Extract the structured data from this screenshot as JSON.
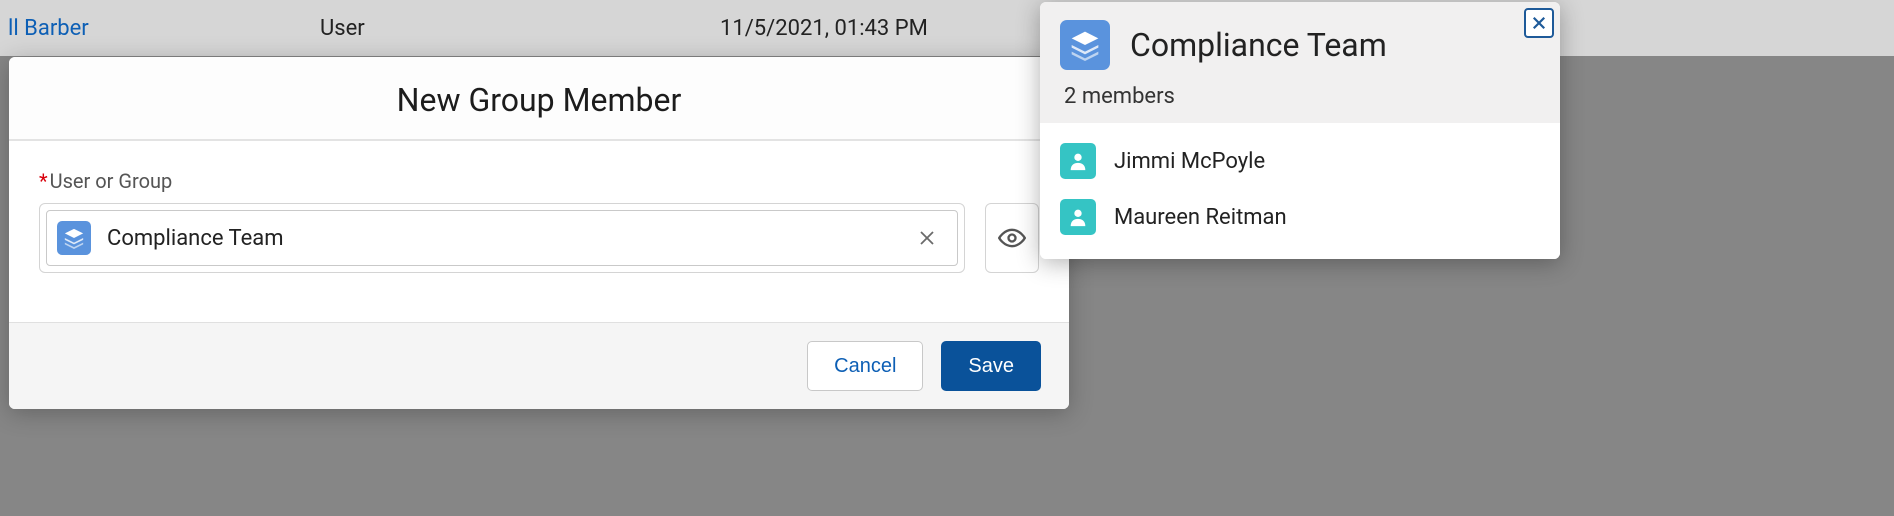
{
  "background_row": {
    "link_text": "ll Barber",
    "type": "User",
    "datetime": "11/5/2021, 01:43 PM"
  },
  "modal": {
    "title": "New Group Member",
    "field": {
      "label": "User or Group",
      "selected_value": "Compliance Team"
    },
    "buttons": {
      "cancel": "Cancel",
      "save": "Save"
    }
  },
  "popover": {
    "title": "Compliance Team",
    "subtitle": "2 members",
    "members": [
      {
        "name": "Jimmi McPoyle"
      },
      {
        "name": "Maureen Reitman"
      }
    ]
  }
}
